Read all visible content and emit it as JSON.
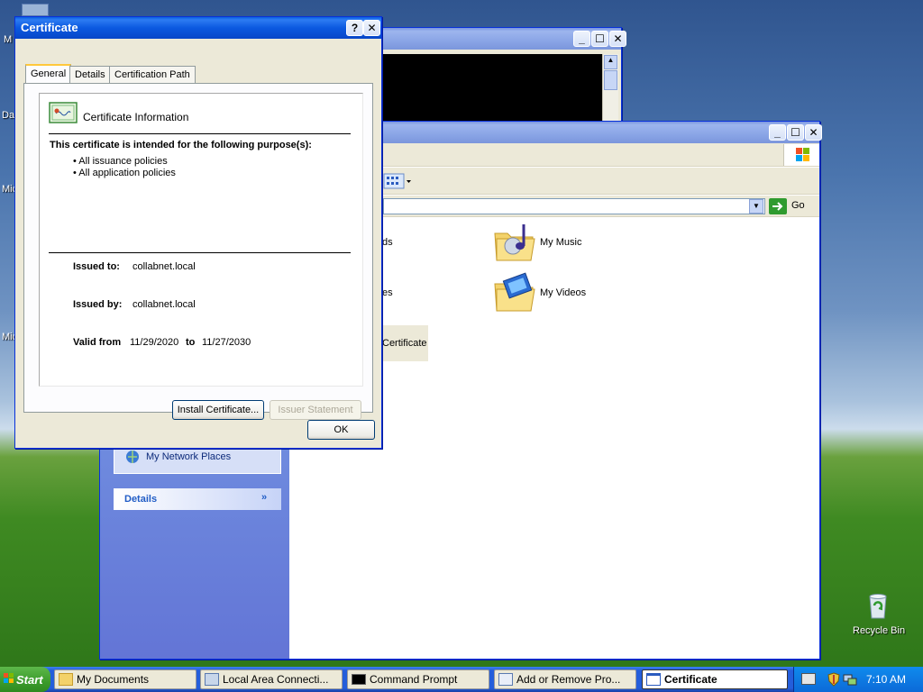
{
  "desktop": {
    "left_labels": [
      "M",
      "Da",
      "Mic",
      "Mic"
    ],
    "recycle_bin": "Recycle Bin"
  },
  "cmd_window": {},
  "explorer": {
    "go_label": "Go",
    "items": [
      {
        "label": "ds"
      },
      {
        "label": "My Music"
      },
      {
        "label": "es"
      },
      {
        "label": "My Videos"
      },
      {
        "label": "Certificate"
      }
    ],
    "left_panel": {
      "network_places": "My Network Places",
      "details_header": "Details"
    }
  },
  "cert": {
    "title": "Certificate",
    "help_btn": "?",
    "close_btn": "✕",
    "tabs": [
      "General",
      "Details",
      "Certification Path"
    ],
    "info_heading": "Certificate Information",
    "purpose_heading": "This certificate is intended for the following purpose(s):",
    "purposes": [
      "• All issuance policies",
      "• All application policies"
    ],
    "issued_to_label": "Issued to:",
    "issued_to_value": "collabnet.local",
    "issued_by_label": "Issued by:",
    "issued_by_value": "collabnet.local",
    "valid_from_label": "Valid from",
    "valid_from_value": "11/29/2020",
    "to_label": "to",
    "valid_to_value": "11/27/2030",
    "install_btn": "Install Certificate...",
    "issuer_btn": "Issuer Statement",
    "ok_btn": "OK"
  },
  "taskbar": {
    "start": "Start",
    "tasks": [
      "My Documents",
      "Local Area Connecti...",
      "Command Prompt",
      "Add or Remove Pro...",
      "Certificate"
    ],
    "clock": "7:10 AM"
  }
}
